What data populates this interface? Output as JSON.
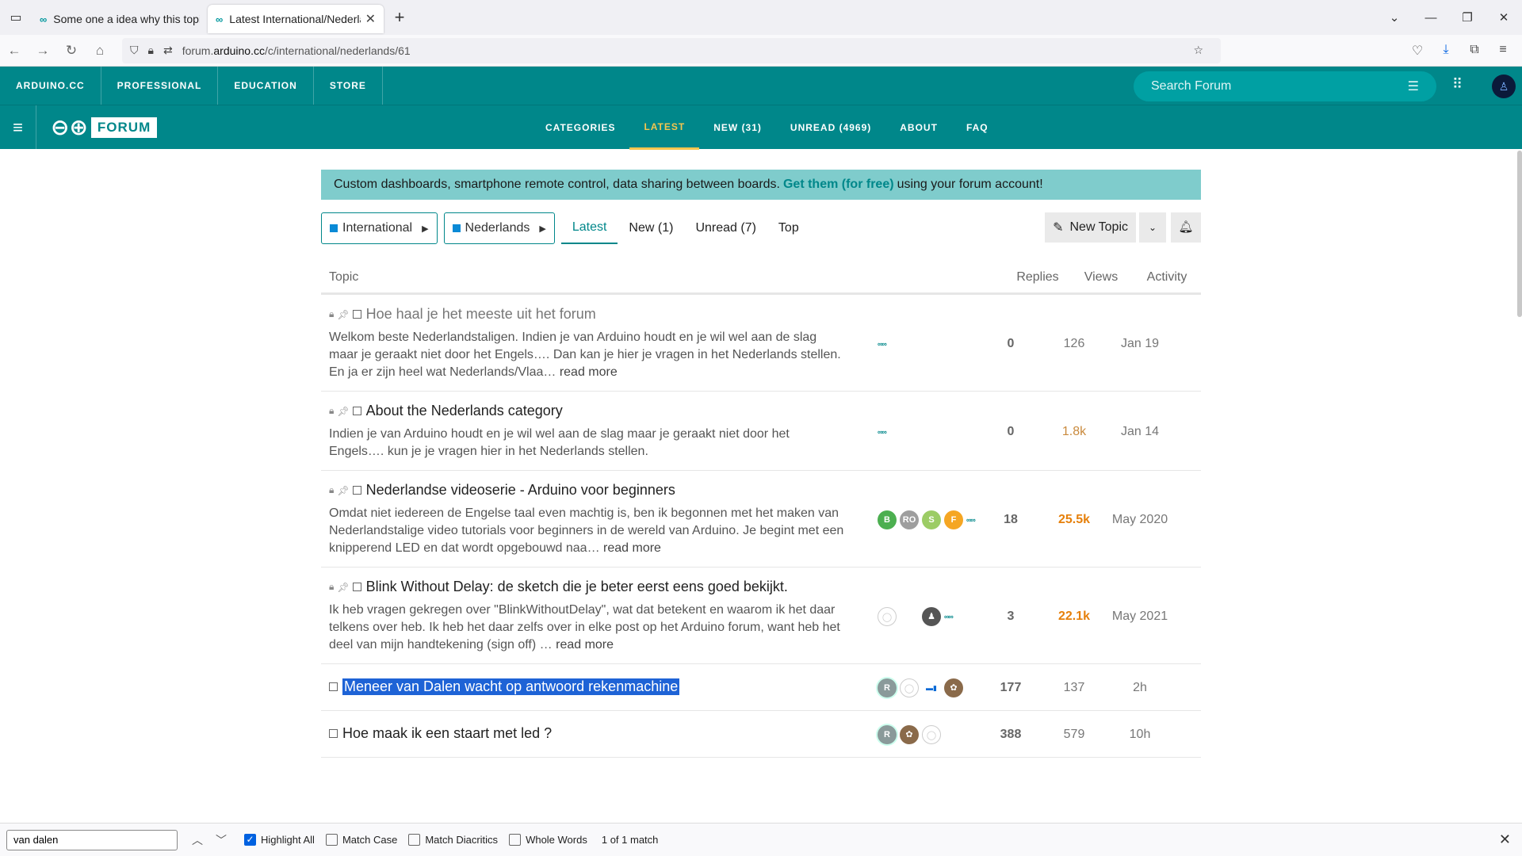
{
  "browser": {
    "tabs": [
      {
        "title": "Some one a idea why this topic",
        "active": false
      },
      {
        "title": "Latest International/Nederlands",
        "active": true
      }
    ],
    "url_prefix": "forum.",
    "url_domain": "arduino.cc",
    "url_path": "/c/international/nederlands/61"
  },
  "site_nav": [
    "ARDUINO.CC",
    "PROFESSIONAL",
    "EDUCATION",
    "STORE"
  ],
  "search": {
    "placeholder": "Search Forum"
  },
  "forum": {
    "logo_text": "FORUM",
    "nav": [
      {
        "label": "CATEGORIES",
        "active": false
      },
      {
        "label": "LATEST",
        "active": true
      },
      {
        "label": "NEW (31)",
        "active": false
      },
      {
        "label": "UNREAD (4969)",
        "active": false
      },
      {
        "label": "ABOUT",
        "active": false
      },
      {
        "label": "FAQ",
        "active": false
      }
    ]
  },
  "banner": {
    "before": "Custom dashboards, smartphone remote control, data sharing between boards.",
    "link": "Get them (for free)",
    "after": "using your forum account!"
  },
  "filters": {
    "breadcrumbs": [
      "International",
      "Nederlands"
    ],
    "tabs": [
      {
        "label": "Latest",
        "active": true
      },
      {
        "label": "New (1)",
        "active": false
      },
      {
        "label": "Unread (7)",
        "active": false
      },
      {
        "label": "Top",
        "active": false
      }
    ],
    "new_topic": "New Topic"
  },
  "table": {
    "headers": {
      "topic": "Topic",
      "replies": "Replies",
      "views": "Views",
      "activity": "Activity"
    },
    "rows": [
      {
        "title": "Hoe haal je het meeste uit het forum",
        "excerpt": "Welkom beste Nederlandstaligen. Indien je van Arduino houdt en je wil wel aan de slag maar je geraakt niet door het Engels…. Dan kan je hier je vragen in het Nederlands stellen. En ja er zijn heel wat Nederlands/Vlaa…",
        "read_more": "read more",
        "replies": "0",
        "views": "126",
        "activity": "Jan 19"
      },
      {
        "title": "About the Nederlands category",
        "excerpt": "Indien je van Arduino houdt en je wil wel aan de slag maar je geraakt niet door het Engels…. kun je je vragen hier in het Nederlands stellen.",
        "read_more": "",
        "replies": "0",
        "views": "1.8k",
        "activity": "Jan 14"
      },
      {
        "title": "Nederlandse videoserie - Arduino voor beginners",
        "excerpt": "Omdat niet iedereen de Engelse taal even machtig is, ben ik begonnen met het maken van Nederlandstalige video tutorials voor beginners in de wereld van Arduino. Je begint met een knipperend LED en dat wordt opgebouwd naa…",
        "read_more": "read more",
        "replies": "18",
        "views": "25.5k",
        "activity": "May 2020"
      },
      {
        "title": "Blink Without Delay: de sketch die je beter eerst eens goed bekijkt.",
        "excerpt": "Ik heb vragen gekregen over \"BlinkWithoutDelay\", wat dat betekent en waarom ik het daar telkens over heb. Ik heb het daar zelfs over in elke post op het Arduino forum, want heb het deel van mijn handtekening (sign off) …",
        "read_more": "read more",
        "replies": "3",
        "views": "22.1k",
        "activity": "May 2021"
      },
      {
        "title": "Meneer van Dalen wacht op antwoord rekenmachine",
        "replies": "177",
        "views": "137",
        "activity": "2h"
      },
      {
        "title": "Hoe maak ik een staart met led ?",
        "replies": "388",
        "views": "579",
        "activity": "10h"
      }
    ],
    "avatars_row3": [
      "B",
      "RO",
      "S",
      "F"
    ],
    "avatar_r": "R"
  },
  "findbar": {
    "query": "van dalen",
    "options": [
      {
        "label": "Highlight All",
        "checked": true
      },
      {
        "label": "Match Case",
        "checked": false
      },
      {
        "label": "Match Diacritics",
        "checked": false
      },
      {
        "label": "Whole Words",
        "checked": false
      }
    ],
    "status": "1 of 1 match"
  }
}
